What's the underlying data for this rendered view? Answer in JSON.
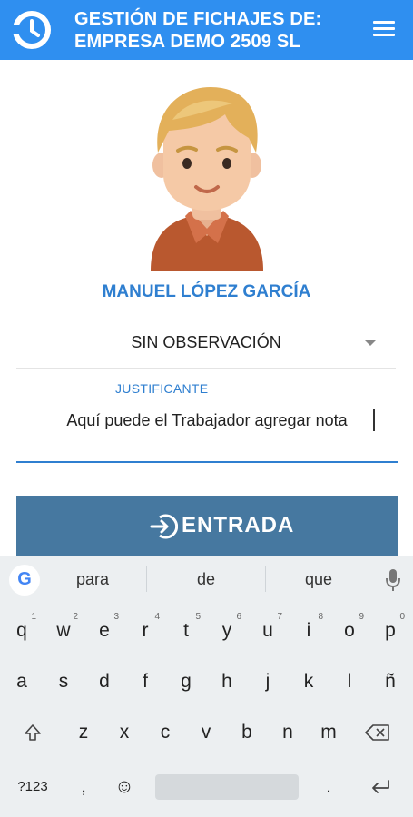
{
  "app_bar": {
    "title_line1": "GESTIÓN DE FICHAJES DE:",
    "title_line2": "EMPRESA DEMO 2509 SL",
    "logo_icon": "clock-logo-icon",
    "menu_icon": "hamburger-menu-icon",
    "brand_color": "#2f8ff0"
  },
  "employee": {
    "name": "MANUEL LÓPEZ GARCÍA",
    "avatar_icon": "employee-avatar"
  },
  "observation": {
    "selected": "SIN OBSERVACIÓN"
  },
  "justificante": {
    "label": "JUSTIFICANTE",
    "value": "Aquí puede el Trabajador agregar nota"
  },
  "entry_button": {
    "label": "ENTRADA",
    "icon": "sign-in-icon",
    "color": "#4678a0"
  },
  "keyboard": {
    "suggestions": [
      "para",
      "de",
      "que"
    ],
    "row1": [
      {
        "k": "q",
        "h": "1"
      },
      {
        "k": "w",
        "h": "2"
      },
      {
        "k": "e",
        "h": "3"
      },
      {
        "k": "r",
        "h": "4"
      },
      {
        "k": "t",
        "h": "5"
      },
      {
        "k": "y",
        "h": "6"
      },
      {
        "k": "u",
        "h": "7"
      },
      {
        "k": "i",
        "h": "8"
      },
      {
        "k": "o",
        "h": "9"
      },
      {
        "k": "p",
        "h": "0"
      }
    ],
    "row2": [
      "a",
      "s",
      "d",
      "f",
      "g",
      "h",
      "j",
      "k",
      "l",
      "ñ"
    ],
    "row3": [
      "z",
      "x",
      "c",
      "v",
      "b",
      "n",
      "m"
    ],
    "symbols_key": "?123",
    "comma_key": ",",
    "period_key": ".",
    "emoji_key": "☺",
    "shift_icon": "shift-icon",
    "backspace_icon": "backspace-icon",
    "enter_icon": "enter-icon",
    "mic_icon": "microphone-icon"
  }
}
